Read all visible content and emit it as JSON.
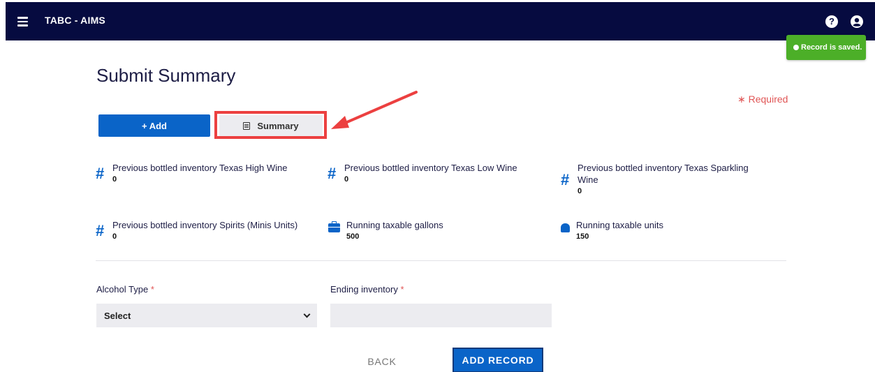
{
  "header": {
    "app_title": "TABC - AIMS",
    "help_glyph": "?",
    "menu_icon": "hamburger-menu-icon",
    "help_icon": "question-circle-icon",
    "user_icon": "user-circle-icon",
    "bg_color": "#060b40"
  },
  "toast": {
    "message": "Record is saved.",
    "color": "#4caf28"
  },
  "page": {
    "title": "Submit Summary",
    "required_note": "∗ Required"
  },
  "actions": {
    "add_label": "+  Add",
    "summary_label": "Summary",
    "summary_icon": "document-icon",
    "highlight_color": "#ec4040",
    "accent_color": "#0a64c8"
  },
  "stats": [
    {
      "icon": "hash-icon",
      "label": "Previous bottled inventory Texas High Wine",
      "value": "0"
    },
    {
      "icon": "hash-icon",
      "label": "Previous bottled inventory Texas Low Wine",
      "value": "0"
    },
    {
      "icon": "hash-icon",
      "label": "Previous bottled inventory Texas Sparkling Wine",
      "value": "0"
    },
    {
      "icon": "hash-icon",
      "label": "Previous bottled inventory Spirits (Minis Units)",
      "value": "0"
    },
    {
      "icon": "briefcase-icon",
      "label": "Running taxable gallons",
      "value": "500"
    },
    {
      "icon": "cylinder-icon",
      "label": "Running taxable units",
      "value": "150"
    }
  ],
  "form": {
    "alcohol_type_label": "Alcohol Type",
    "alcohol_type_value": "Select",
    "ending_inventory_label": "Ending inventory",
    "ending_inventory_value": "",
    "required_mark": "*"
  },
  "footer": {
    "back_label": "BACK",
    "add_record_label": "ADD RECORD"
  }
}
